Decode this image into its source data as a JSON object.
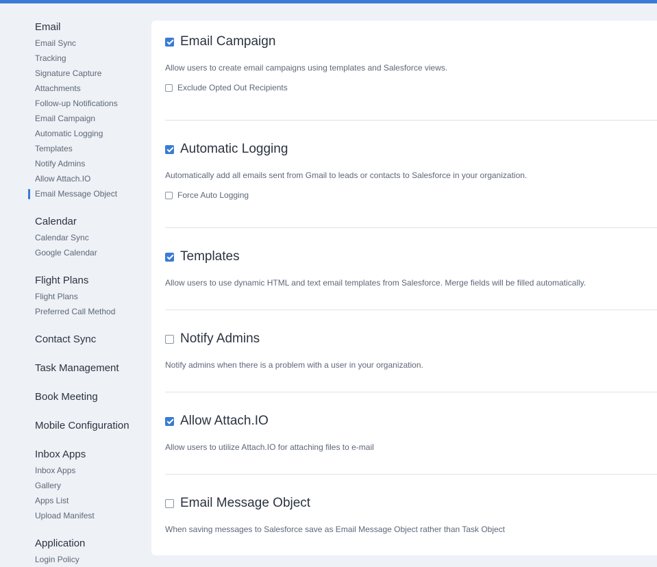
{
  "sidebar": {
    "groups": [
      {
        "heading": "Email",
        "items": [
          "Email Sync",
          "Tracking",
          "Signature Capture",
          "Attachments",
          "Follow-up Notifications",
          "Email Campaign",
          "Automatic Logging",
          "Templates",
          "Notify Admins",
          "Allow Attach.IO",
          "Email Message Object"
        ]
      },
      {
        "heading": "Calendar",
        "items": [
          "Calendar Sync",
          "Google Calendar"
        ]
      },
      {
        "heading": "Flight Plans",
        "items": [
          "Flight Plans",
          "Preferred Call Method"
        ]
      },
      {
        "heading": "Contact Sync",
        "items": []
      },
      {
        "heading": "Task Management",
        "items": []
      },
      {
        "heading": "Book Meeting",
        "items": []
      },
      {
        "heading": "Mobile Configuration",
        "items": []
      },
      {
        "heading": "Inbox Apps",
        "items": [
          "Inbox Apps",
          "Gallery",
          "Apps List",
          "Upload Manifest"
        ]
      },
      {
        "heading": "Application",
        "items": [
          "Login Policy"
        ]
      }
    ],
    "active_item": "Email Message Object"
  },
  "settings": [
    {
      "title": "Email Campaign",
      "checked": true,
      "description": "Allow users to create email campaigns using templates and Salesforce views.",
      "sub_option": {
        "label": "Exclude Opted Out Recipients",
        "checked": false
      }
    },
    {
      "title": "Automatic Logging",
      "checked": true,
      "description": "Automatically add all emails sent from Gmail to leads or contacts to Salesforce in your organization.",
      "sub_option": {
        "label": "Force Auto Logging",
        "checked": false
      }
    },
    {
      "title": "Templates",
      "checked": true,
      "description": "Allow users to use dynamic HTML and text email templates from Salesforce. Merge fields will be filled automatically."
    },
    {
      "title": "Notify Admins",
      "checked": false,
      "description": "Notify admins when there is a problem with a user in your organization."
    },
    {
      "title": "Allow Attach.IO",
      "checked": true,
      "description": "Allow users to utilize Attach.IO for attaching files to e-mail"
    },
    {
      "title": "Email Message Object",
      "checked": false,
      "description": "When saving messages to Salesforce save as Email Message Object rather than Task Object"
    }
  ]
}
